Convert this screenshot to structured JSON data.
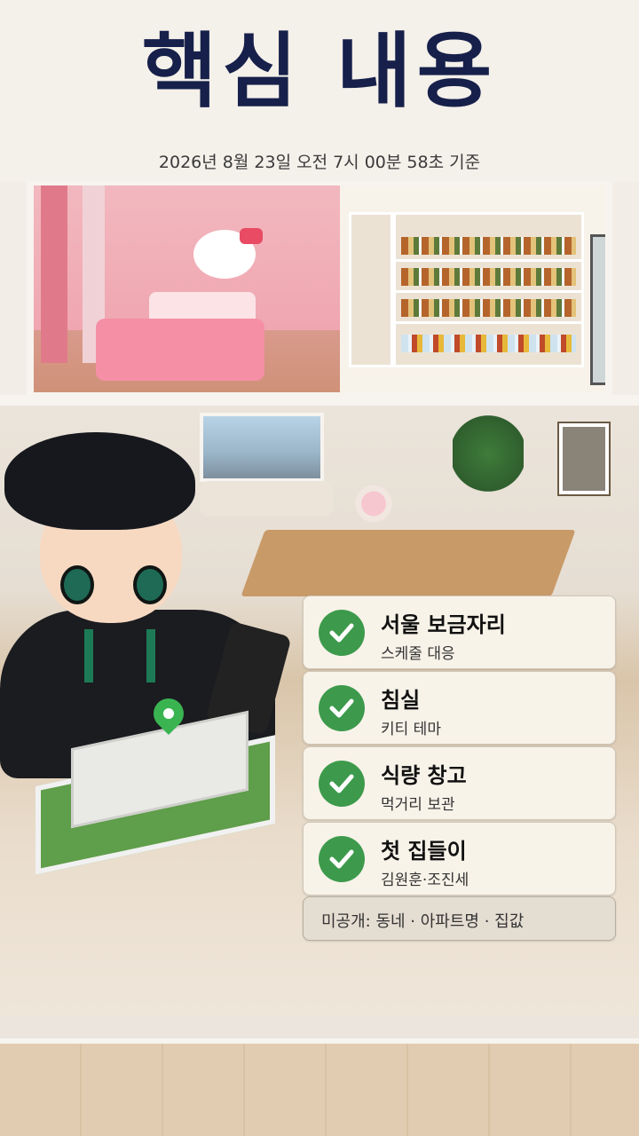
{
  "header": {
    "title": "핵심 내용",
    "timestamp": "2026년 8월 23일 오전 7시 00분 58초 기준"
  },
  "checklist": {
    "items": [
      {
        "title": "서울 보금자리",
        "subtitle": "스케줄 대응",
        "icon": "check-icon"
      },
      {
        "title": "침실",
        "subtitle": "키티 테마",
        "icon": "check-icon"
      },
      {
        "title": "식량 창고",
        "subtitle": "먹거리 보관",
        "icon": "check-icon"
      },
      {
        "title": "첫 집들이",
        "subtitle": "김원훈·조진세",
        "icon": "check-icon"
      }
    ],
    "note": "미공개: 동네 · 아파트명 · 집값"
  },
  "colors": {
    "title": "#16204a",
    "check_green": "#3d9a4c",
    "card_bg": "#f8f3e9",
    "note_bg": "#e4ddd2"
  }
}
